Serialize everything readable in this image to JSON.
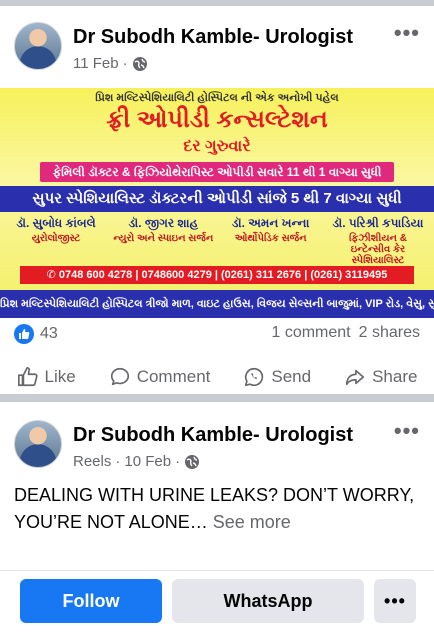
{
  "post1": {
    "author": "Dr Subodh Kamble- Urologist",
    "date": "11 Feb",
    "more": "•••",
    "banner": {
      "intro": "પ્રિશ મલ્ટિસ્પેશિયાલિટી હોસ્પિટલ ની એક અનોખી પહેલ",
      "headline": "ફ્રી ઓપીડી કન્સલ્ટેશન",
      "day": "દર ગુરુવારે",
      "family_line": "ફેમિલી ડૉક્ટર & ફિઝિયોથેરાપિસ્ટ ઓપીડી સવારે 11 થી 1 વાગ્યા સુધી",
      "super_line": "સુપર સ્પેશિયાલિસ્ટ ડૉક્ટરની ઓપીડી સાંજે 5 થી 7 વાગ્યા સુધી",
      "doctors": [
        {
          "name": "ડૉ. સુબોધ કાંબલે",
          "spec": "યુરોલોજીસ્ટ"
        },
        {
          "name": "ડૉ. જીગર શાહ",
          "spec": "ન્યુરો અને સ્પાઇન સર્જન"
        },
        {
          "name": "ડૉ. અમન ખન્ના",
          "spec": "ઓર્થોપેડિક સર્જન"
        },
        {
          "name": "ડૉ. પરિશ્રી કપાડિયા",
          "spec": "ફિઝીશીયન & ઇન્ટેન્સીવ કેર સ્પેશિયાલિસ્ટ"
        }
      ],
      "phones": "0748 600 4278 | 0748600 4279 | (0261) 311 2676 | (0261) 3119495",
      "address": "પ્રિશ મલ્ટિસ્પેશિયાલિટી હોસ્પિટલ ત્રીજો માળ, વાઇટ હાઉસ, વિજય સેલ્સની બાજુમાં, VIP રોડ, વેસુ, સુરત"
    },
    "likes": "43",
    "comments": "1 comment",
    "shares": "2 shares",
    "actions": {
      "like": "Like",
      "comment": "Comment",
      "send": "Send",
      "share": "Share"
    }
  },
  "post2": {
    "author": "Dr Subodh Kamble- Urologist",
    "meta_prefix": "Reels",
    "date": "10 Feb",
    "more": "•••",
    "text": "DEALING WITH URINE LEAKS? DON’T WORRY, YOU’RE NOT ALONE…",
    "see_more": "See more"
  },
  "bottom": {
    "follow": "Follow",
    "whatsapp": "WhatsApp",
    "more": "•••"
  },
  "colors": {
    "brand_blue": "#1877f2",
    "banner_yellow": "#f6f15a",
    "banner_red": "#e31b23",
    "banner_navy": "#2a2fae"
  }
}
